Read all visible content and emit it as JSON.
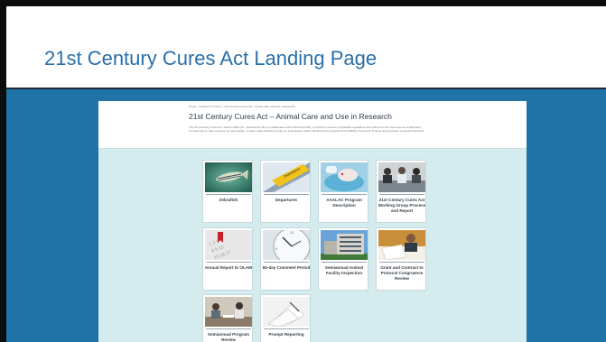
{
  "slide": {
    "title": "21st Century Cures Act Landing Page"
  },
  "page": {
    "breadcrumb": "Home  >  Guidance & Policy  >  21st Century Cures Act  -  Animal Care and Use in Research",
    "heading": "21st Century Cures Act – Animal Care and Use in Research",
    "description": "The 21st Century Cures Act, Section 2034 (d) – directed the NIH, in collaboration with USDA and FDA, to conduct a review of applicable regulations and policies for the care and use of laboratory animals and to make revisions, as appropriate, to reduce administrative burden on investigators while maintaining the integrity and credibility of research findings and protection of research animals."
  },
  "tiles": [
    {
      "label": "Zebrafish",
      "icon": "zebrafish-photo"
    },
    {
      "label": "Departures",
      "icon": "departures-sign-photo"
    },
    {
      "label": "AAALAC Program Description",
      "icon": "lab-animal-photo"
    },
    {
      "label": "21st Century Cures Act Working Group Process and Report",
      "icon": "meeting-photo"
    },
    {
      "label": "Annual Report to OLAW",
      "icon": "calendar-photo"
    },
    {
      "label": "60-day Comment Period",
      "icon": "clock-photo"
    },
    {
      "label": "Semiannual Animal Facility Inspection",
      "icon": "building-photo"
    },
    {
      "label": "Grant and Contract to Protocol Congruence Review",
      "icon": "paperwork-photo"
    },
    {
      "label": "Semiannual Program Review",
      "icon": "review-meeting-photo"
    },
    {
      "label": "Prompt Reporting",
      "icon": "documents-photo"
    }
  ]
}
